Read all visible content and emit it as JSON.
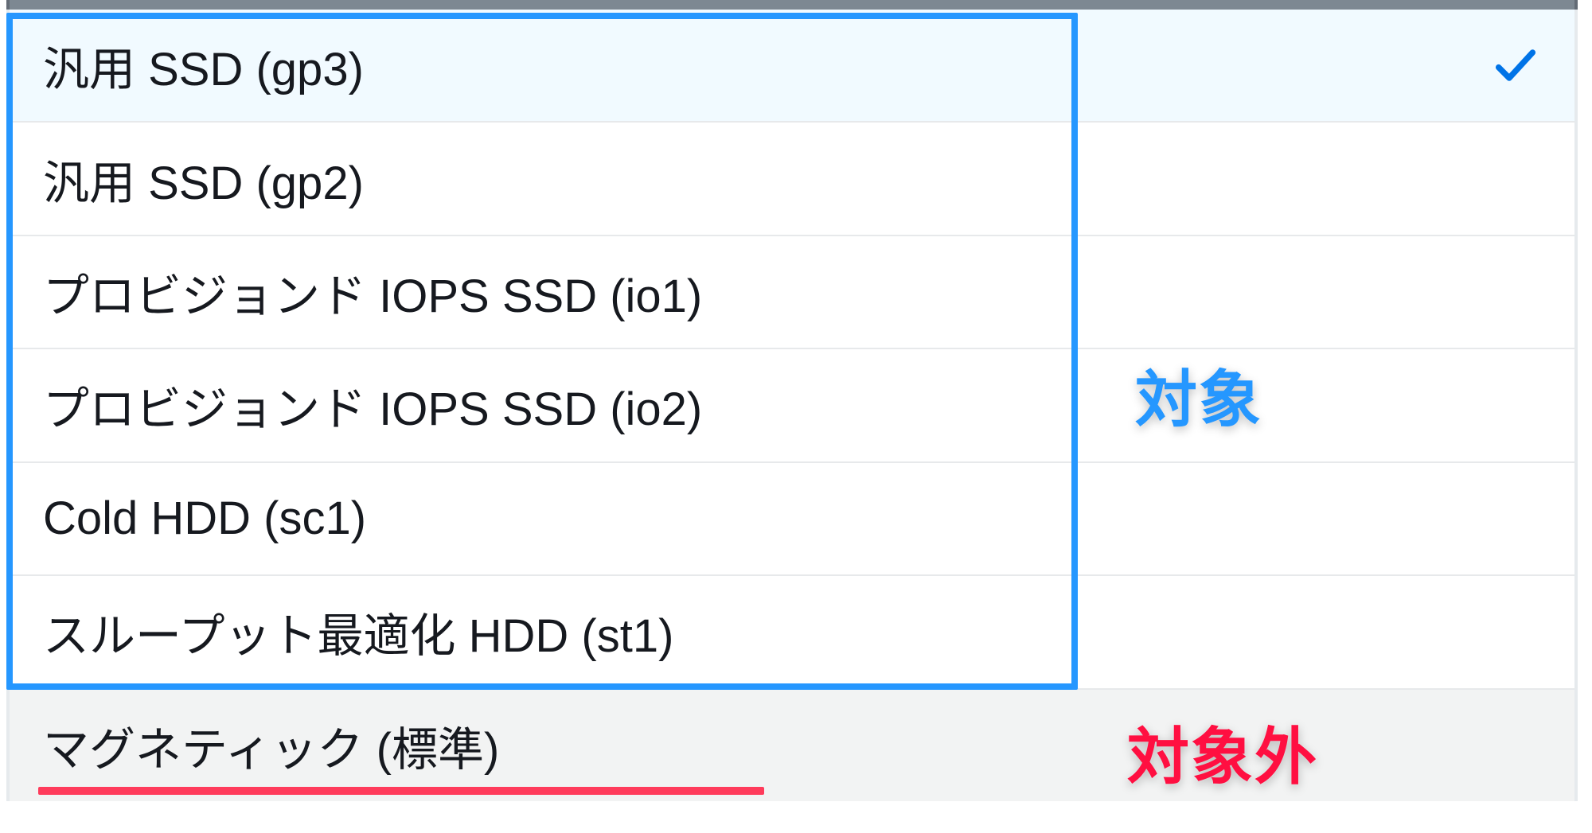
{
  "options": [
    {
      "label": "汎用 SSD (gp3)",
      "selected": true
    },
    {
      "label": "汎用 SSD (gp2)"
    },
    {
      "label": "プロビジョンド IOPS SSD (io1)"
    },
    {
      "label": "プロビジョンド IOPS SSD (io2)"
    },
    {
      "label": "Cold HDD (sc1)"
    },
    {
      "label": "スループット最適化 HDD (st1)"
    },
    {
      "label": "マグネティック (標準)",
      "hover": true
    }
  ],
  "annotations": {
    "included": "対象",
    "excluded": "対象外"
  }
}
